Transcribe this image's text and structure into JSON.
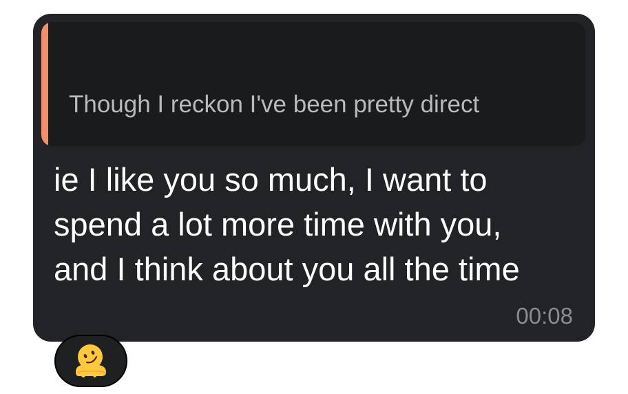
{
  "message": {
    "quoted_text": "Though I reckon I've been pretty direct",
    "quote_accent_color": "#f48e6c",
    "body_lines": [
      "ie I like you so much, I want to",
      "spend a lot more time with you,",
      "and I think about you all the time"
    ],
    "timestamp": "00:08",
    "reaction": {
      "icon": "melting-face-emoji-icon"
    }
  }
}
